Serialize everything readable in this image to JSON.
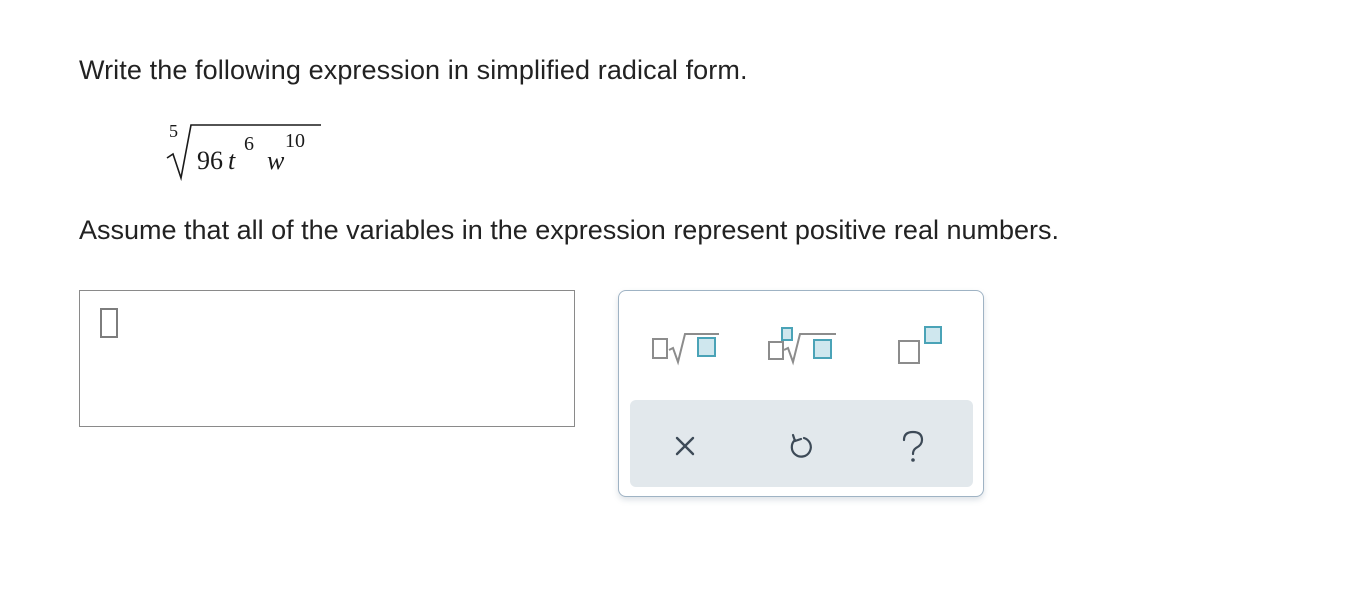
{
  "question": {
    "prompt": "Write the following expression in simplified radical form.",
    "expression": {
      "index": "5",
      "coefficient": "96",
      "var1": "t",
      "exp1": "6",
      "var2": "w",
      "exp2": "10"
    },
    "assumption": "Assume that all of the variables in the expression represent positive real numbers."
  },
  "answer": {
    "value": ""
  },
  "palette": {
    "tools": [
      {
        "name": "radical-template-button",
        "icon": "square-root-icon"
      },
      {
        "name": "nth-root-template-button",
        "icon": "nth-root-icon"
      },
      {
        "name": "exponent-template-button",
        "icon": "superscript-icon"
      }
    ],
    "actions": [
      {
        "name": "clear-button",
        "icon": "close-icon"
      },
      {
        "name": "undo-button",
        "icon": "undo-icon"
      },
      {
        "name": "help-button",
        "icon": "help-icon"
      }
    ]
  },
  "colors": {
    "text": "#222222",
    "accent_teal": "#4aa3b7",
    "template_gray": "#8c8c8c",
    "palette_border": "#9fb3c4",
    "action_bar_bg": "#e2e8ec",
    "action_icon": "#3d4a57"
  }
}
